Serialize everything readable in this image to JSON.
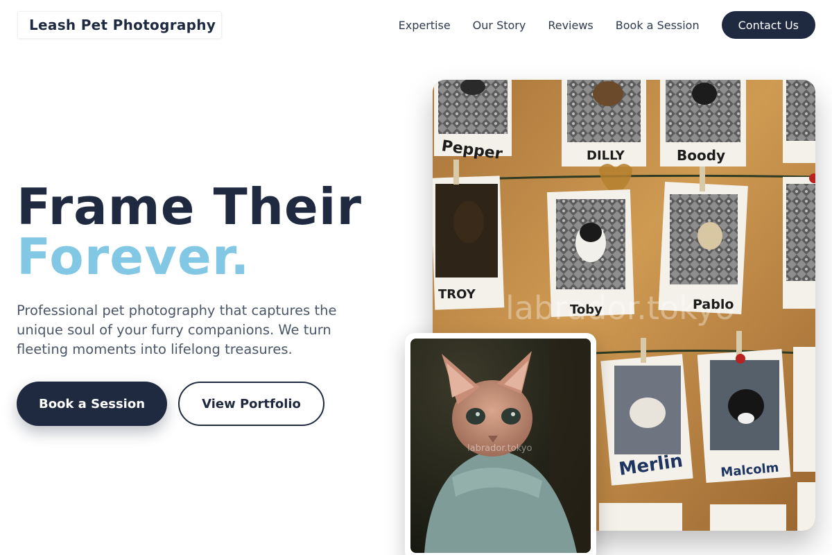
{
  "brand": {
    "name": "Leash Pet Photography"
  },
  "nav": {
    "links": [
      "Expertise",
      "Our Story",
      "Reviews",
      "Book a Session"
    ],
    "cta": "Contact Us"
  },
  "hero": {
    "title_line1": "Frame Their",
    "title_line2": "Forever.",
    "subtitle": "Professional pet photography that captures the unique soul of your furry companions. We turn fleeting moments into lifelong treasures.",
    "primary_button": "Book a Session",
    "secondary_button": "View Portfolio"
  },
  "gallery": {
    "watermark": "labrador.tokyo",
    "polaroid_names": [
      "Pepper",
      "DILLY",
      "Boody",
      "TROY",
      "Toby",
      "Pablo",
      "Merlin",
      "Malcolm"
    ]
  },
  "colors": {
    "navy": "#1f2a40",
    "accent_blue": "#82c8e5",
    "body_text": "#4b5666",
    "corkboard": "#c8954a"
  }
}
